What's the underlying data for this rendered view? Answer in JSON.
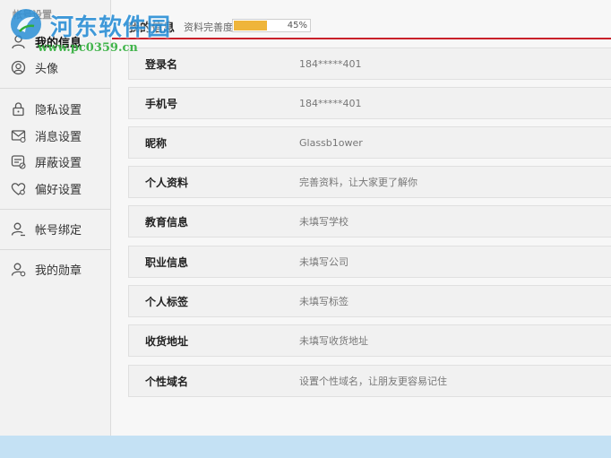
{
  "sidebar": {
    "header": "帐号设置",
    "items": [
      {
        "label": "我的信息",
        "icon": "user-info-icon",
        "active": true
      },
      {
        "label": "头像",
        "icon": "avatar-icon",
        "active": false
      },
      {
        "label": "隐私设置",
        "icon": "lock-icon",
        "active": false
      },
      {
        "label": "消息设置",
        "icon": "message-icon",
        "active": false
      },
      {
        "label": "屏蔽设置",
        "icon": "block-icon",
        "active": false
      },
      {
        "label": "偏好设置",
        "icon": "heart-icon",
        "active": false
      },
      {
        "label": "帐号绑定",
        "icon": "bind-user-icon",
        "active": false
      },
      {
        "label": "我的勋章",
        "icon": "medal-user-icon",
        "active": false
      }
    ]
  },
  "header": {
    "title": "我的信息",
    "progress_label": "资料完善度",
    "progress_value": 45,
    "progress_text": "45%"
  },
  "rows": [
    {
      "label": "登录名",
      "value": "184*****401"
    },
    {
      "label": "手机号",
      "value": "184*****401"
    },
    {
      "label": "昵称",
      "value": "Glassb1ower"
    },
    {
      "label": "个人资料",
      "value": "完善资料，让大家更了解你"
    },
    {
      "label": "教育信息",
      "value": "未填写学校"
    },
    {
      "label": "职业信息",
      "value": "未填写公司"
    },
    {
      "label": "个人标签",
      "value": "未填写标签"
    },
    {
      "label": "收货地址",
      "value": "未填写收货地址"
    },
    {
      "label": "个性域名",
      "value": "设置个性域名，让朋友更容易记住"
    }
  ],
  "watermark": {
    "title": "河东软件园",
    "url": "www.pc0359.cn"
  },
  "colors": {
    "accent_red": "#c9202a",
    "progress": "#efb53a",
    "watermark_blue": "#2b8fd6",
    "watermark_green": "#2fae3a",
    "bottom_strip": "#c4e1f4"
  }
}
